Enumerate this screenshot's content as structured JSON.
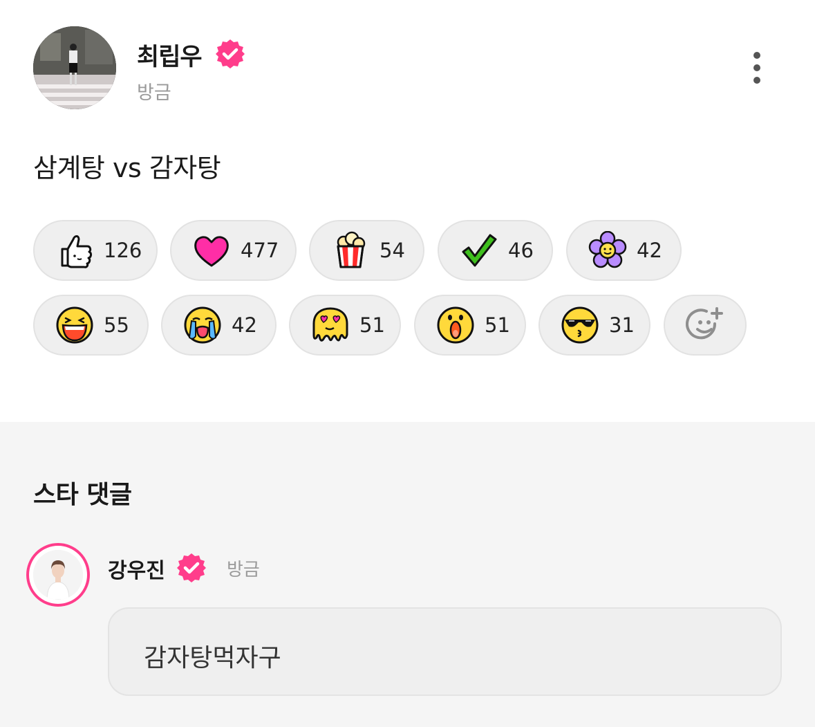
{
  "post": {
    "author": "최립우",
    "time": "방금",
    "text": "삼계탕 vs 감자탕"
  },
  "reactions": [
    {
      "icon": "thumbs-up-icon",
      "count": "126"
    },
    {
      "icon": "heart-icon",
      "count": "477"
    },
    {
      "icon": "popcorn-icon",
      "count": "54"
    },
    {
      "icon": "checkmark-icon",
      "count": "46"
    },
    {
      "icon": "flower-icon",
      "count": "42"
    },
    {
      "icon": "laughing-face-icon",
      "count": "55"
    },
    {
      "icon": "crying-face-icon",
      "count": "42"
    },
    {
      "icon": "heart-eyes-melting-face-icon",
      "count": "51"
    },
    {
      "icon": "surprised-face-icon",
      "count": "51"
    },
    {
      "icon": "sunglasses-kiss-face-icon",
      "count": "31"
    }
  ],
  "add_reaction_icon": "add-emoji-icon",
  "comments_section": {
    "title": "스타 댓글",
    "comments": [
      {
        "author": "강우진",
        "time": "방금",
        "text": "감자탕먹자구"
      }
    ]
  },
  "colors": {
    "verified_badge": "#ff3d8b",
    "pill_bg": "#efefef",
    "section_bg": "#f5f5f5"
  }
}
